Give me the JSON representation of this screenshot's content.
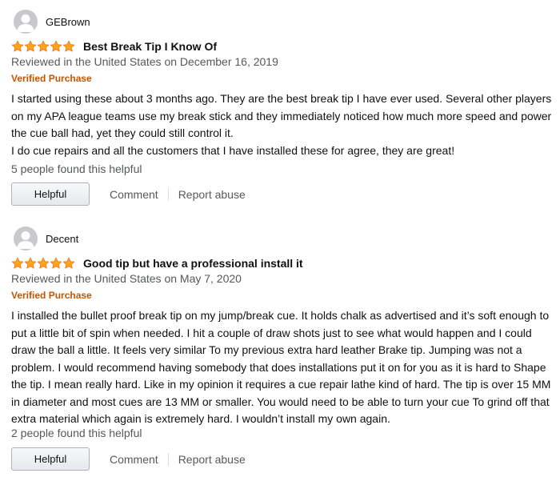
{
  "reviews": [
    {
      "author": "GEBrown",
      "rating": 5,
      "title": "Best Break Tip I Know Of",
      "date": "Reviewed in the United States on December 16, 2019",
      "verified": "Verified Purchase",
      "body": "I started using these about 3 months ago. They are the best break tip I have ever used. Several other players on my APA league teams use my break stick and they immediately noticed how much more speed and power the cue ball had, yet they could still control it.\nI do cue repairs and all the customers that I have installed these for agree, they are great!",
      "helpful_count": "5 people found this helpful",
      "helpful_button": "Helpful",
      "comment_link": "Comment",
      "report_link": "Report abuse"
    },
    {
      "author": "Decent",
      "rating": 5,
      "title": "Good tip but have a professional install it",
      "date": "Reviewed in the United States on May 7, 2020",
      "verified": "Verified Purchase",
      "body": "I installed the bullet proof break tip on my jump/break cue. It holds chalk as advertised and it’s soft enough to put a little bit of spin when needed. I hit a couple of draw shots just to see what would happen and I could draw the ball a little. It feels very similar To my previous extra hard leather Brake tip. Jumping was not a problem. I would recommend having somebody that does installations put it on for you as it is hard to Shape the tip. I mean really hard. Like in my opinion it requires a cue repair lathe kind of hard. The tip is over 15 MM in diameter and most cues are 13 MM or smaller. You would need to be able to turn your cue To grind off that extra material which again is extremely hard. I wouldn’t install my own again.",
      "helpful_count": "2 people found this helpful",
      "helpful_button": "Helpful",
      "comment_link": "Comment",
      "report_link": "Report abuse"
    }
  ],
  "icons": {
    "avatar": "user-avatar-icon",
    "star": "star-icon"
  },
  "colors": {
    "star": "#ffa41c",
    "star_stroke": "#de7921",
    "verified": "#c45500",
    "muted": "#565959"
  }
}
